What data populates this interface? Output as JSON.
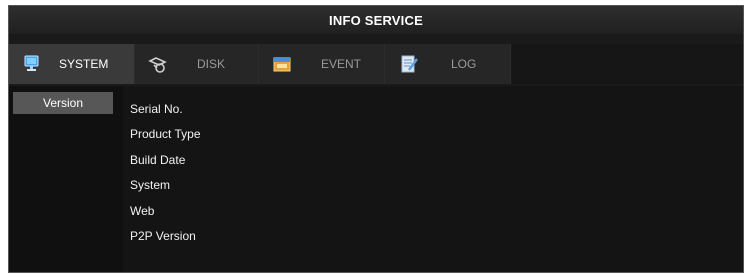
{
  "window": {
    "title": "INFO SERVICE"
  },
  "tabs": [
    {
      "id": "system",
      "label": "SYSTEM",
      "icon": "monitor-icon",
      "active": true
    },
    {
      "id": "disk",
      "label": "DISK",
      "icon": "disk-icon",
      "active": false
    },
    {
      "id": "event",
      "label": "EVENT",
      "icon": "event-icon",
      "active": false
    },
    {
      "id": "log",
      "label": "LOG",
      "icon": "log-icon",
      "active": false
    }
  ],
  "sidebar": {
    "items": [
      {
        "label": "Version",
        "selected": true
      }
    ]
  },
  "info": {
    "rows": [
      {
        "label": "Serial No."
      },
      {
        "label": "Product Type"
      },
      {
        "label": "Build Date"
      },
      {
        "label": "System"
      },
      {
        "label": "Web"
      },
      {
        "label": "P2P Version"
      }
    ]
  },
  "colors": {
    "background": "#1a1a1a",
    "active_tab": "#3a3a3a",
    "sidebar_selected": "#575757",
    "text": "#ffffff",
    "inactive_text": "#9a9a9a"
  }
}
